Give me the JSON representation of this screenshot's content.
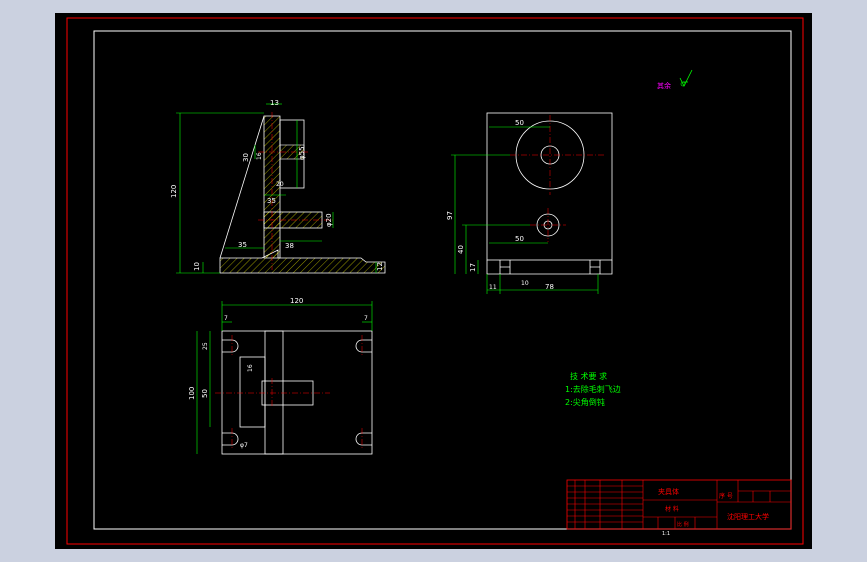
{
  "colors": {
    "background": "#000000",
    "border_red": "#ff0000",
    "geometry_white": "#ffffff",
    "dimension_green": "#00ff00",
    "hatch_yellow": "#ffff00",
    "annotation_magenta": "#ff00ff",
    "centerline_red": "#ff0000"
  },
  "roughness_note": "其余",
  "front_view": {
    "dims": {
      "d13": "13",
      "d120": "120",
      "d35a": "35",
      "d35b": "35",
      "d38": "38",
      "d10": "10",
      "d12": "12",
      "d20": "20",
      "d16": "16",
      "d30": "30",
      "d55": "φ55",
      "d20b": "φ20"
    }
  },
  "side_view": {
    "dims": {
      "d50a": "50",
      "d50b": "50",
      "d97": "97",
      "d40": "40",
      "d17": "17",
      "d11": "11",
      "d78": "78",
      "d10": "10"
    }
  },
  "top_view": {
    "dims": {
      "d120": "120",
      "d7a": "7",
      "d7b": "7",
      "d25": "25",
      "d100": "100",
      "d50": "50",
      "d16": "16",
      "d7c": "φ7"
    }
  },
  "tech_notes": {
    "title": "技 术要 求",
    "item1": "1:去除毛刺飞边",
    "item2": "2:尖角倒钝"
  },
  "title_block": {
    "part_name": "夹具体",
    "material": "材 料",
    "sequence": "序 号",
    "school": "沈阳理工大学",
    "scale_label": "比 例",
    "sheet": "1:1"
  }
}
